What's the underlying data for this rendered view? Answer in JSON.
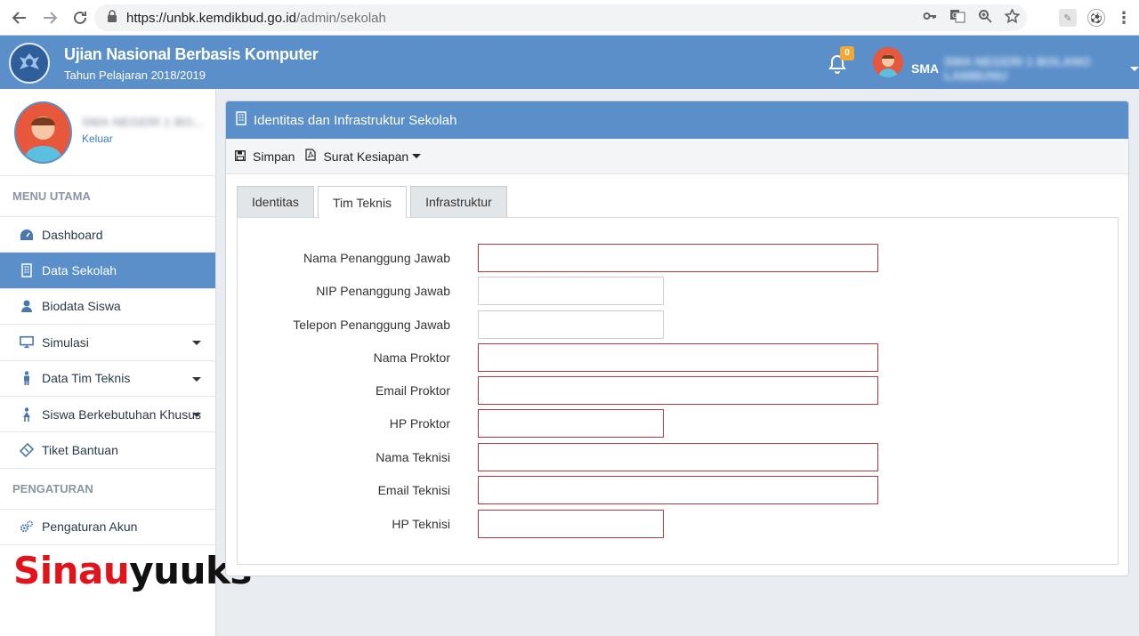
{
  "browser": {
    "url_host": "https://unbk.kemdikbud.go.id",
    "url_path": "/admin/sekolah"
  },
  "header": {
    "title": "Ujian Nasional Berbasis Komputer",
    "subtitle": "Tahun Pelajaran 2018/2019",
    "notification_count": "0",
    "user_name": "SMA NEGERI 1 BOLANO LAMBUNU"
  },
  "sidebar": {
    "profile_name": "SMA NEGERI 1 BO...",
    "logout_label": "Keluar",
    "section_main": "MENU UTAMA",
    "items": [
      {
        "label": "Dashboard",
        "icon": "dashboard-icon"
      },
      {
        "label": "Data Sekolah",
        "icon": "building-icon"
      },
      {
        "label": "Biodata Siswa",
        "icon": "user-icon"
      },
      {
        "label": "Simulasi",
        "icon": "monitor-icon"
      },
      {
        "label": "Data Tim Teknis",
        "icon": "person-icon"
      },
      {
        "label": "Siswa Berkebutuhan Khusus",
        "icon": "child-icon"
      },
      {
        "label": "Tiket Bantuan",
        "icon": "ticket-icon"
      }
    ],
    "section_settings": "PENGATURAN",
    "settings_items": [
      {
        "label": "Pengaturan Akun",
        "icon": "gears-icon"
      }
    ]
  },
  "watermark": {
    "part1": "Sinau",
    "part2": "yuuks"
  },
  "panel": {
    "title": "Identitas dan Infrastruktur Sekolah",
    "toolbar": {
      "save_label": "Simpan",
      "letter_label": "Surat Kesiapan"
    },
    "tabs": [
      {
        "label": "Identitas"
      },
      {
        "label": "Tim Teknis"
      },
      {
        "label": "Infrastruktur"
      }
    ],
    "active_tab": "Tim Teknis",
    "fields": [
      {
        "label": "Nama Penanggung Jawab",
        "value": ""
      },
      {
        "label": "NIP Penanggung Jawab",
        "value": ""
      },
      {
        "label": "Telepon Penanggung Jawab",
        "value": ""
      },
      {
        "label": "Nama Proktor",
        "value": ""
      },
      {
        "label": "Email Proktor",
        "value": ""
      },
      {
        "label": "HP Proktor",
        "value": ""
      },
      {
        "label": "Nama Teknisi",
        "value": ""
      },
      {
        "label": "Email Teknisi",
        "value": ""
      },
      {
        "label": "HP Teknisi",
        "value": ""
      }
    ]
  },
  "colors": {
    "header_bg": "#5b8fca",
    "active_menu_bg": "#5b8fca",
    "invalid_border": "#b03a3a",
    "badge_bg": "#f0a935"
  }
}
